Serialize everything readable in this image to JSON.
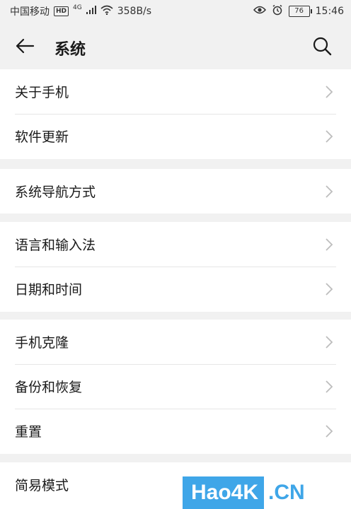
{
  "status_bar": {
    "carrier": "中国移动",
    "hd": "HD",
    "network": "4G",
    "speed": "358B/s",
    "battery": "76",
    "time": "15:46"
  },
  "header": {
    "title": "系统",
    "back_icon": "back-arrow-icon",
    "search_icon": "search-icon"
  },
  "sections": [
    {
      "items": [
        {
          "label": "关于手机"
        },
        {
          "label": "软件更新"
        }
      ]
    },
    {
      "items": [
        {
          "label": "系统导航方式"
        }
      ]
    },
    {
      "items": [
        {
          "label": "语言和输入法"
        },
        {
          "label": "日期和时间"
        }
      ]
    },
    {
      "items": [
        {
          "label": "手机克隆"
        },
        {
          "label": "备份和恢复"
        },
        {
          "label": "重置"
        }
      ]
    },
    {
      "items": [
        {
          "label": "简易模式"
        }
      ]
    }
  ],
  "watermark": {
    "left": "Hao4K",
    "right": ".CN"
  },
  "colors": {
    "background": "#f1f1f1",
    "card": "#ffffff",
    "watermark_blue": "#3fa6e8"
  }
}
